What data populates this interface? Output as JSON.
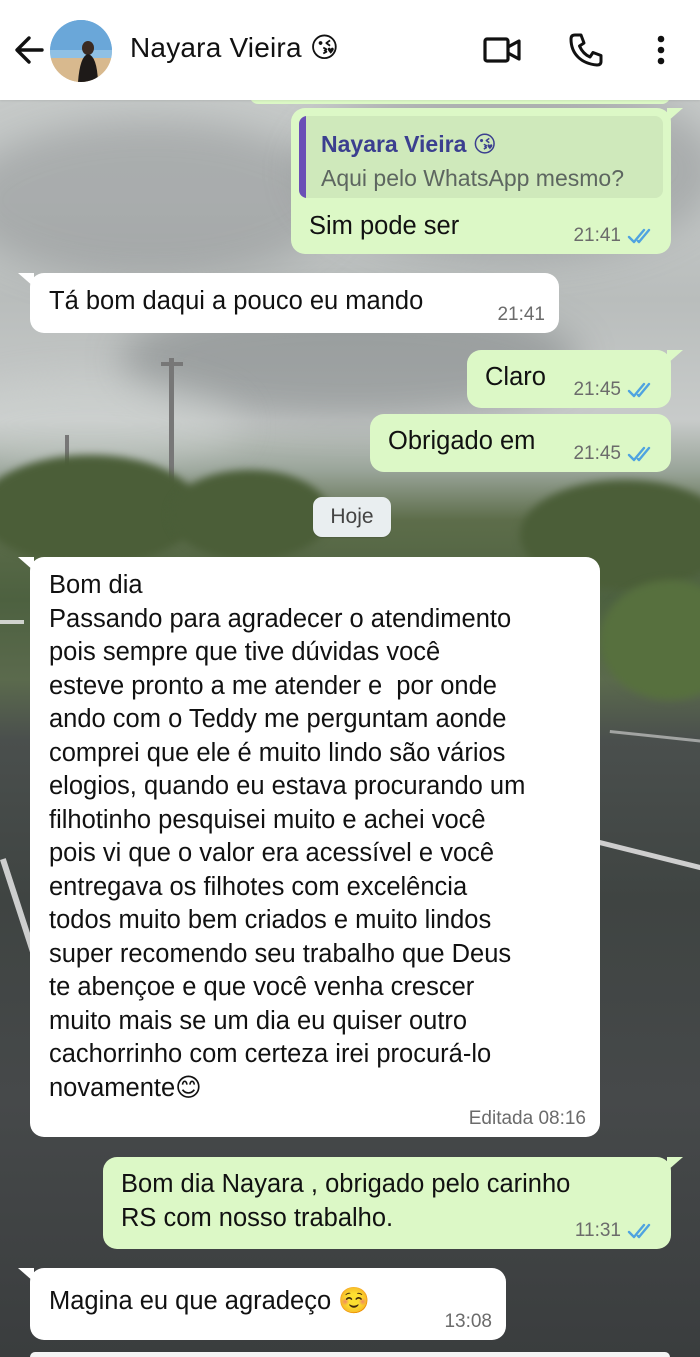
{
  "header": {
    "contact_name": "Nayara Vieira 😘",
    "back_icon": "arrow-left-icon",
    "video_icon": "video-call-icon",
    "call_icon": "phone-icon",
    "menu_icon": "more-vert-icon"
  },
  "colors": {
    "outgoing_bubble": "#dcf8c6",
    "incoming_bubble": "#ffffff",
    "read_tick": "#4fa3e0",
    "quote_bar": "#6a4fb6"
  },
  "messages": [
    {
      "direction": "outgoing",
      "quoted": {
        "name": "Nayara Vieira 😘",
        "text": "Aqui pelo WhatsApp mesmo?"
      },
      "text": "Sim pode ser",
      "time": "21:41",
      "status": "read"
    },
    {
      "direction": "incoming",
      "text": "Tá bom daqui a pouco eu mando",
      "time": "21:41"
    },
    {
      "direction": "outgoing",
      "text": "Claro",
      "time": "21:45",
      "status": "read"
    },
    {
      "direction": "outgoing",
      "text": "Obrigado em",
      "time": "21:45",
      "status": "read"
    },
    {
      "direction": "incoming",
      "text": "Bom dia\nPassando para agradecer o atendimento\npois sempre que tive dúvidas você\nesteve pronto a me atender e  por onde\nando com o Teddy me perguntam aonde\ncomprei que ele é muito lindo são vários\nelogios, quando eu estava procurando um\nfilhotinho pesquisei muito e achei você\npois vi que o valor era acessível e você\nentregava os filhotes com excelência\ntodos muito bem criados e muito lindos\nsuper recomendo seu trabalho que Deus\nte abençoe e que você venha crescer\nmuito mais se um dia eu quiser outro\ncachorrinho com certeza irei procurá-lo\nnovamente😊",
      "time": "Editada 08:16"
    },
    {
      "direction": "outgoing",
      "text": "Bom dia Nayara , obrigado pelo carinho\nRS com nosso trabalho.",
      "time": "11:31",
      "status": "read"
    },
    {
      "direction": "incoming",
      "text": "Magina eu que agradeço ☺️",
      "time": "13:08"
    }
  ],
  "date_separator": "Hoje"
}
